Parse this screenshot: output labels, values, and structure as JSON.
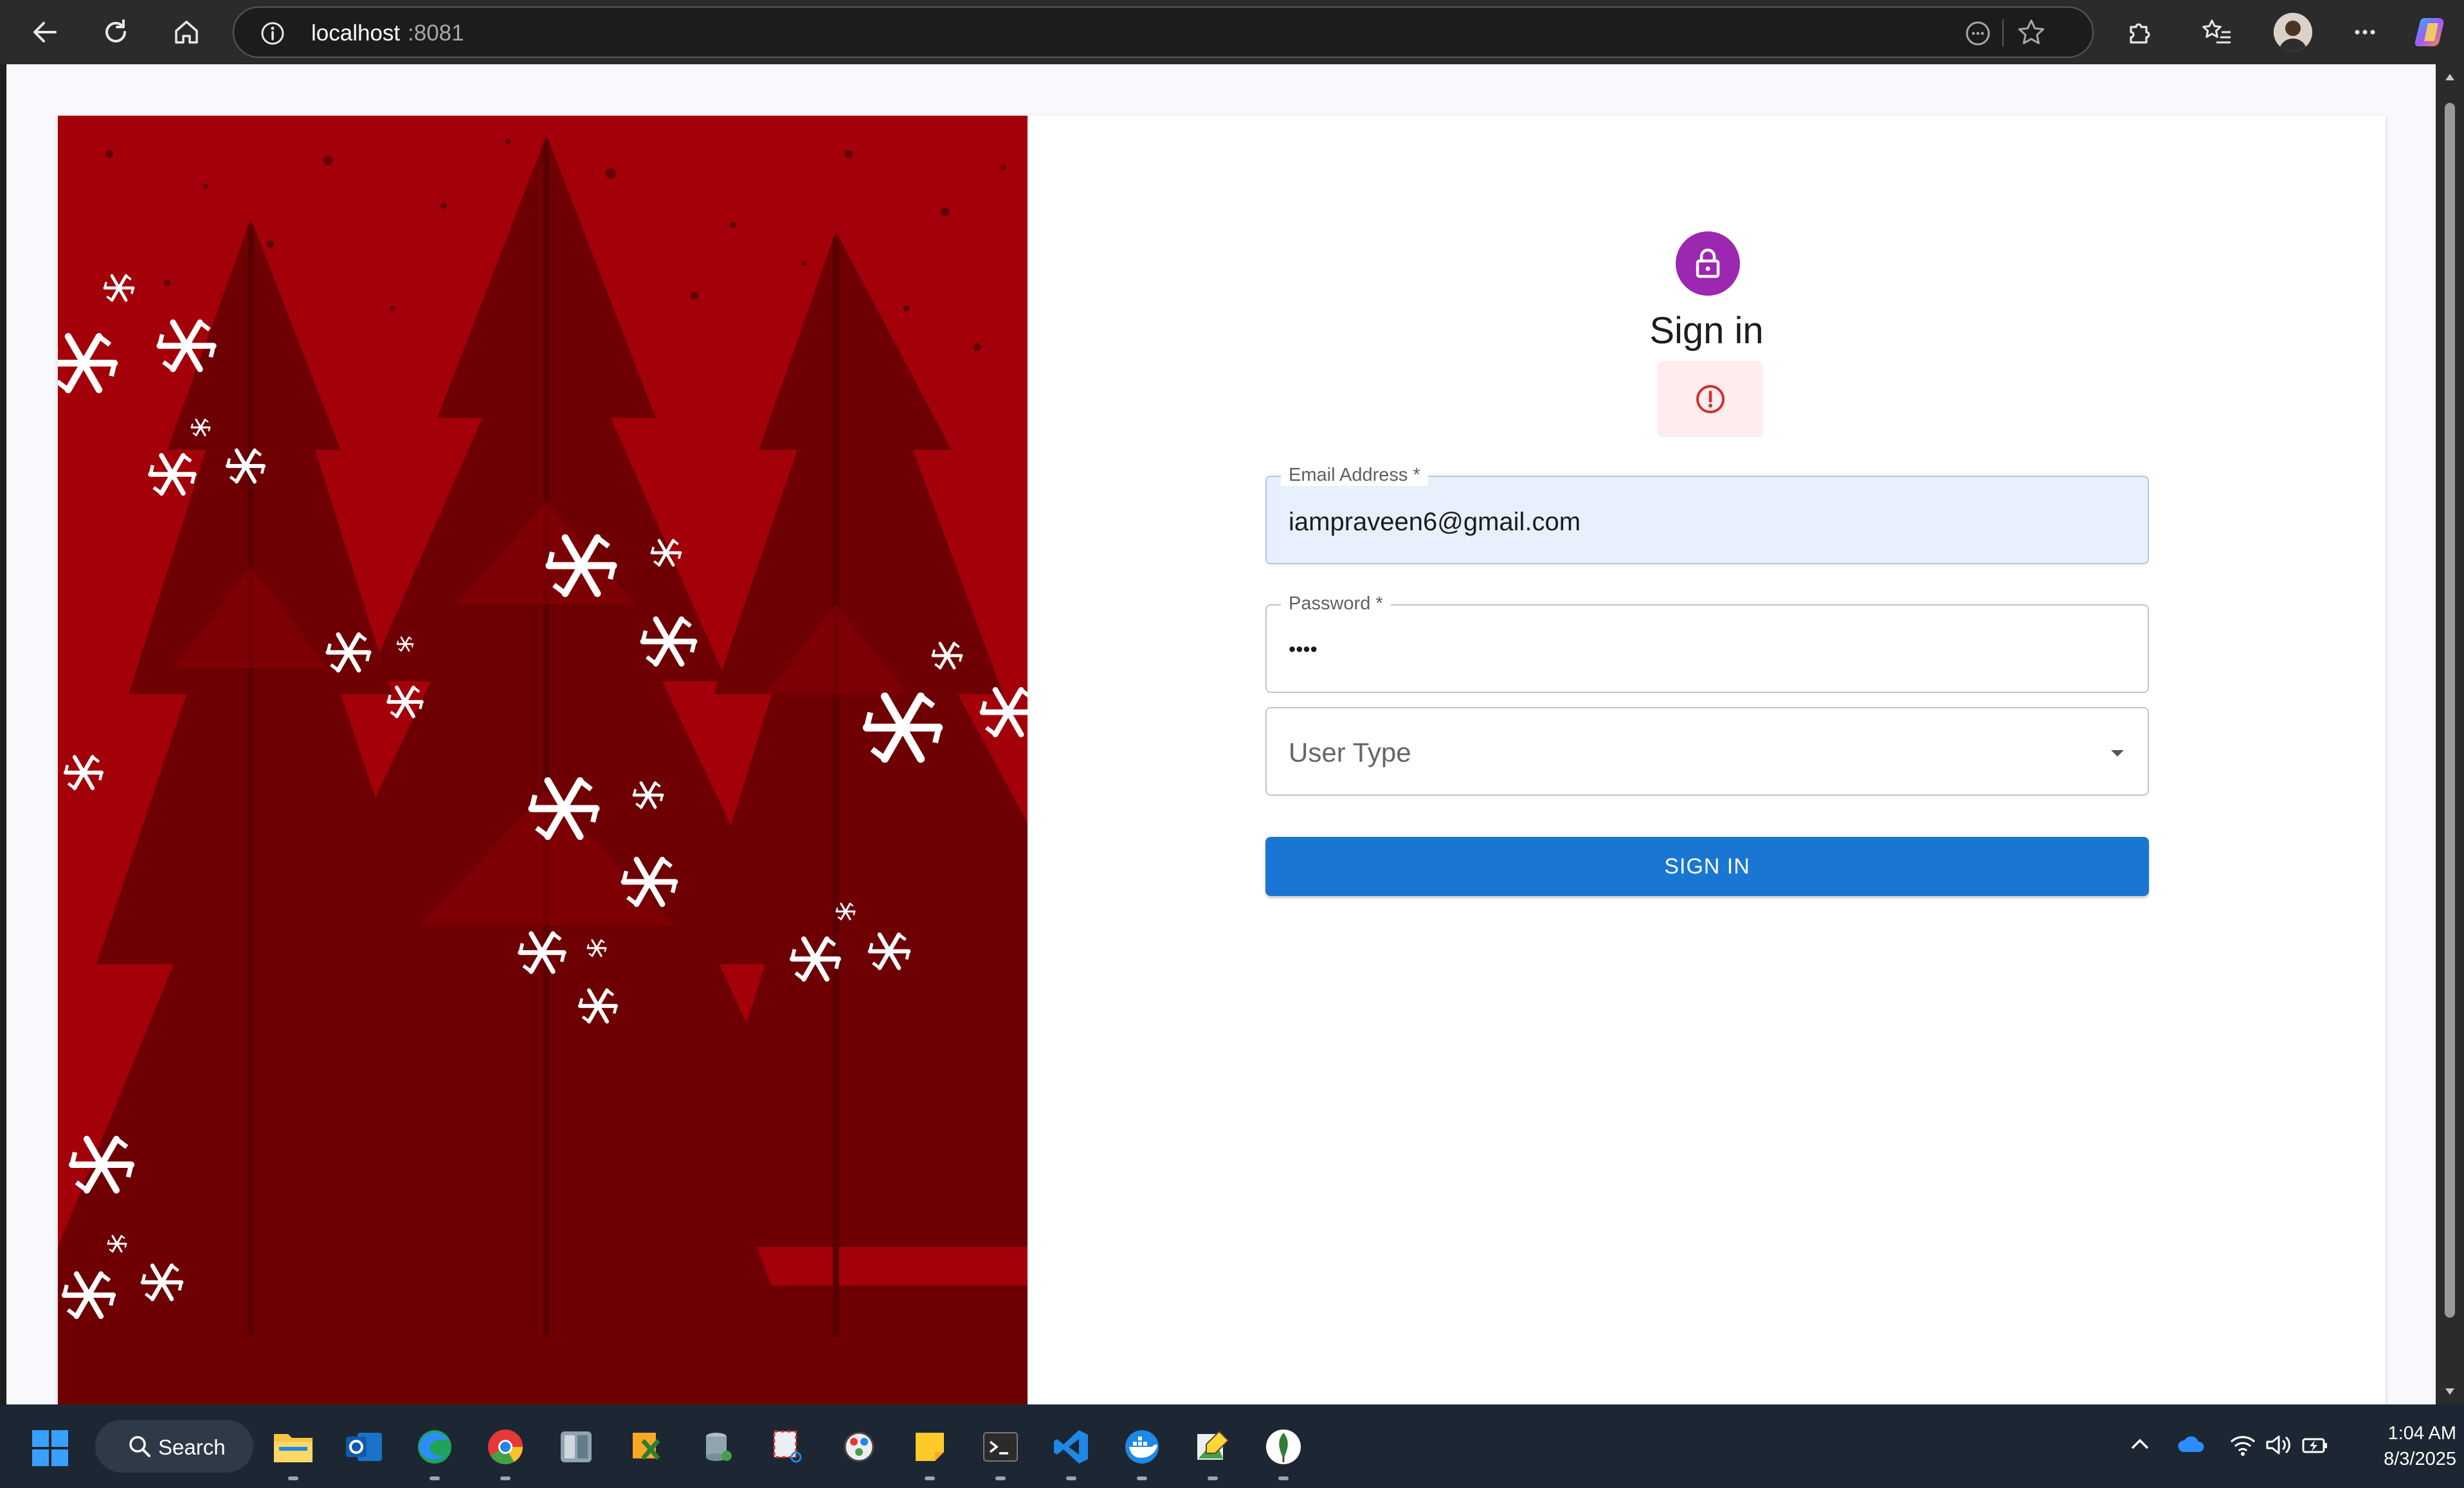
{
  "browser": {
    "url_host": "localhost",
    "url_port": ":8081"
  },
  "page": {
    "title": "Sign in",
    "email": {
      "label": "Email Address *",
      "value": "iampraveen6@gmail.com"
    },
    "password": {
      "label": "Password *",
      "masked_value": "••••"
    },
    "user_type": {
      "placeholder": "User Type"
    },
    "submit_label": "SIGN IN",
    "colors": {
      "avatar": "#9c27b0",
      "primary_button": "#1976d2",
      "error_alert_bg": "#fdeded",
      "error_icon": "#d32f2f",
      "hero_background": "#a3000a"
    }
  },
  "taskbar": {
    "search_label": "Search",
    "time": "1:04 AM",
    "date": "8/3/2025",
    "pinned_apps": [
      "file-explorer-icon",
      "outlook-icon",
      "edge-icon",
      "chrome-icon",
      "photos-icon",
      "excel-tool-icon",
      "database-tool-icon",
      "snipping-tool-icon",
      "paint-icon",
      "sticky-notes-icon",
      "terminal-icon",
      "vscode-icon",
      "docker-icon",
      "image-tool-icon",
      "mongodb-icon"
    ]
  }
}
